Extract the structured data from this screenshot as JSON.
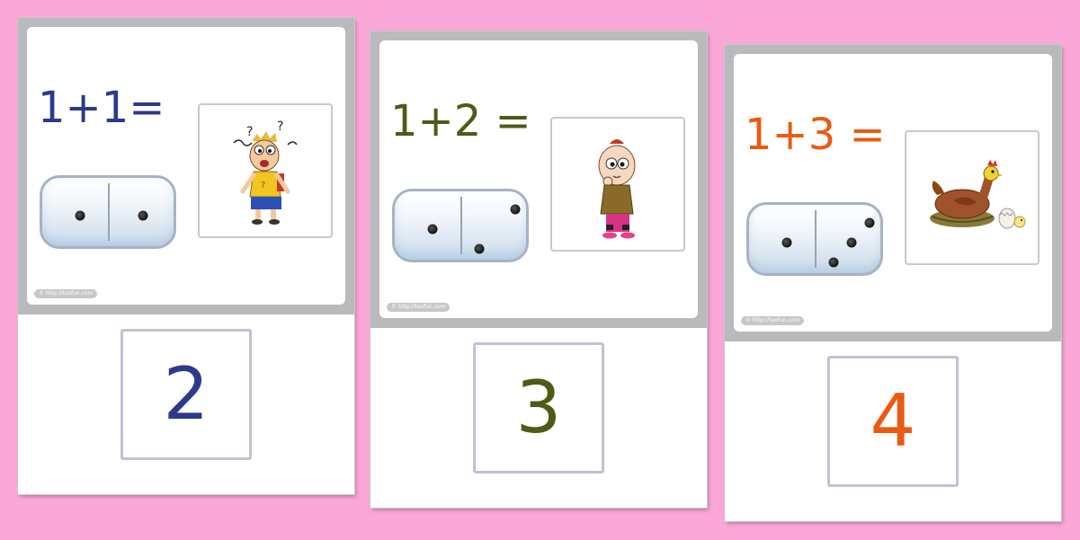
{
  "cards": [
    {
      "equation": "1+1=",
      "answer": "2",
      "color": "#2b3a8a",
      "watermark": "© http://taofun.com",
      "domino": {
        "left_pips": 1,
        "right_pips": 1
      },
      "picture": "confused-boy"
    },
    {
      "equation": "1+2 =",
      "answer": "3",
      "color": "#4f5a17",
      "watermark": "© http://taofun.com",
      "domino": {
        "left_pips": 1,
        "right_pips": 2
      },
      "picture": "thinking-boy"
    },
    {
      "equation": "1+3 =",
      "answer": "4",
      "color": "#ea5a12",
      "watermark": "© http://taofun.com",
      "domino": {
        "left_pips": 1,
        "right_pips": 3
      },
      "picture": "hen-with-egg"
    }
  ]
}
